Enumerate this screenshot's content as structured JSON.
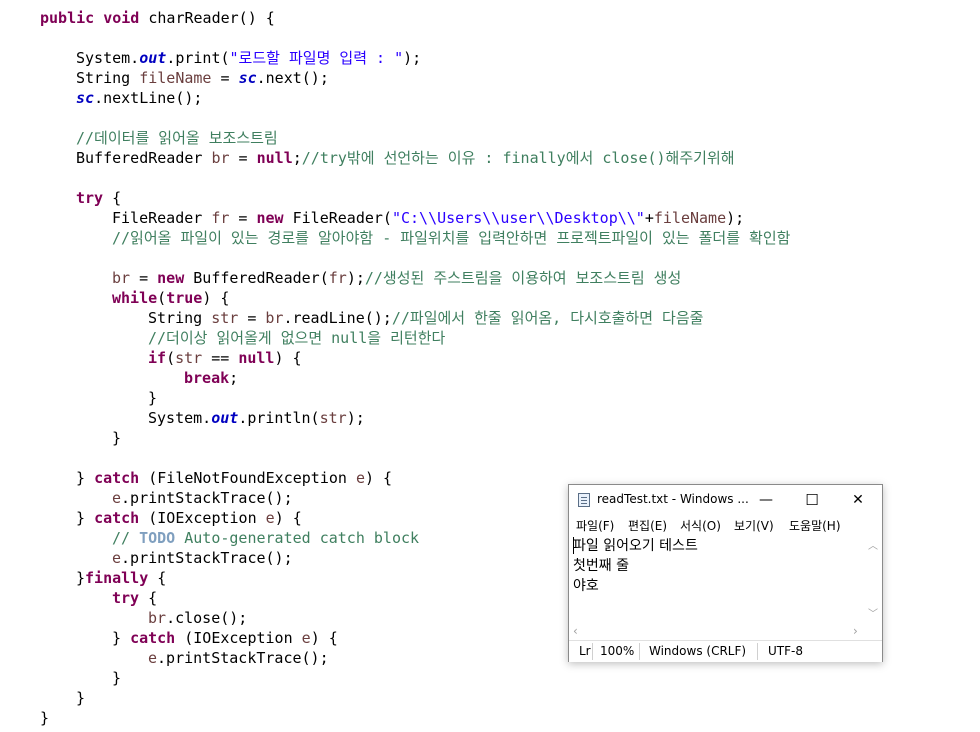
{
  "editor": {
    "lines": {
      "l1": {
        "kw1": "public",
        "kw2": "void",
        "rest": " charReader() {"
      },
      "l3": {
        "a": "System.",
        "fld": "out",
        "b": ".print(",
        "str": "\"로드할 파일명 입력 : \"",
        "c": ");"
      },
      "l4": {
        "a": "String ",
        "var": "fileName",
        "b": " = ",
        "fld": "sc",
        "c": ".next();"
      },
      "l5": {
        "fld": "sc",
        "a": ".nextLine();"
      },
      "l7": {
        "cm": "//데이터를 읽어올 보조스트림"
      },
      "l8": {
        "a": "BufferedReader ",
        "var": "br",
        "b": " = ",
        "kw": "null",
        "c": ";",
        "cm": "//try밖에 선언하는 이유 : finally에서 close()해주기위해"
      },
      "l10": {
        "kw": "try",
        "a": " {"
      },
      "l11": {
        "a": "FileReader ",
        "var": "fr",
        "b": " = ",
        "kw": "new",
        "c": " FileReader(",
        "str": "\"C:\\\\Users\\\\user\\\\Desktop\\\\\"",
        "d": "+",
        "var2": "fileName",
        "e": ");"
      },
      "l12": {
        "cm": "//읽어올 파일이 있는 경로를 알아야함 - 파일위치를 입력안하면 프로젝트파일이 있는 폴더를 확인함"
      },
      "l14": {
        "var": "br",
        "a": " = ",
        "kw": "new",
        "b": " BufferedReader(",
        "var2": "fr",
        "c": ");",
        "cm": "//생성된 주스트림을 이용하여 보조스트림 생성"
      },
      "l15": {
        "kw1": "while",
        "a": "(",
        "kw2": "true",
        "b": ") {"
      },
      "l16": {
        "a": "String ",
        "var": "str",
        "b": " = ",
        "var2": "br",
        "c": ".readLine();",
        "cm": "//파일에서 한줄 읽어옴, 다시호출하면 다음줄"
      },
      "l17": {
        "cm": "//더이상 읽어올게 없으면 null을 리턴한다"
      },
      "l18": {
        "kw1": "if",
        "a": "(",
        "var": "str",
        "b": " == ",
        "kw2": "null",
        "c": ") {"
      },
      "l19": {
        "kw": "break",
        "a": ";"
      },
      "l20": {
        "a": "}"
      },
      "l21": {
        "a": "System.",
        "fld": "out",
        "b": ".println(",
        "var": "str",
        "c": ");"
      },
      "l22": {
        "a": "}"
      },
      "l24": {
        "a": "} ",
        "kw": "catch",
        "b": " (FileNotFoundException ",
        "var": "e",
        "c": ") {"
      },
      "l25": {
        "var": "e",
        "a": ".printStackTrace();"
      },
      "l26": {
        "a": "} ",
        "kw": "catch",
        "b": " (IOException ",
        "var": "e",
        "c": ") {"
      },
      "l27": {
        "cm1": "// ",
        "todo": "TODO",
        "cm2": " Auto-generated catch block"
      },
      "l28": {
        "var": "e",
        "a": ".printStackTrace();"
      },
      "l29": {
        "a": "}",
        "kw": "finally",
        "b": " {"
      },
      "l30": {
        "kw": "try",
        "a": " {"
      },
      "l31": {
        "var": "br",
        "a": ".close();"
      },
      "l32": {
        "a": "} ",
        "kw": "catch",
        "b": " (IOException ",
        "var": "e",
        "c": ") {"
      },
      "l33": {
        "var": "e",
        "a": ".printStackTrace();"
      },
      "l34": {
        "a": "}"
      },
      "l35": {
        "a": "}"
      },
      "l36": {
        "a": "}"
      }
    }
  },
  "notepad": {
    "title": "readTest.txt - Windows ...",
    "controls": {
      "minimize": "—",
      "maximize": "☐",
      "close": "✕"
    },
    "menu": [
      "파일(F)",
      "편집(E)",
      "서식(O)",
      "보기(V)",
      "도움말(H)"
    ],
    "content": [
      "파일 읽어오기 테스트",
      "첫번째 줄",
      "야호"
    ],
    "status": {
      "position": "Lr",
      "zoom": "100%",
      "line_ending": "Windows (CRLF)",
      "encoding": "UTF-8"
    },
    "scroll_arrows": {
      "up": "︿",
      "down": "﹀",
      "left": "‹",
      "right": "›"
    },
    "icon": "notepad-icon"
  }
}
